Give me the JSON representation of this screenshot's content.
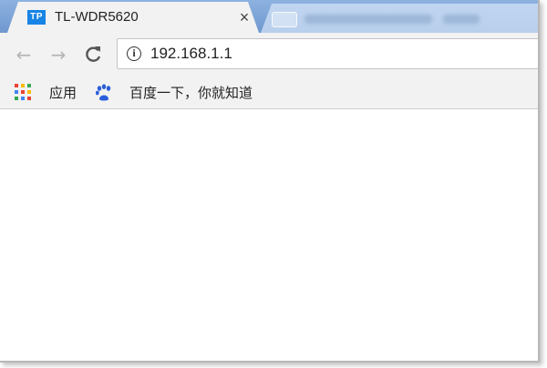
{
  "tabs": [
    {
      "favicon_text": "TP",
      "title": "TL-WDR5620",
      "close": "×",
      "active": true
    },
    {
      "title": "",
      "active": false
    }
  ],
  "toolbar": {
    "back": "←",
    "forward": "→",
    "reload": "C",
    "info_icon": "i",
    "url": "192.168.1.1"
  },
  "bookmarks": {
    "apps_label": "应用",
    "baidu_label": "百度一下，你就知道",
    "apps_icon_colors": [
      "#ea4335",
      "#fbbc05",
      "#34a853",
      "#4285f4",
      "#ea4335",
      "#fbbc05",
      "#34a853",
      "#4285f4",
      "#ea4335"
    ]
  },
  "colors": {
    "tabstrip": "#7aa3d6",
    "favicon_bg": "#1784e6",
    "baidu_blue": "#2b5fd9"
  }
}
